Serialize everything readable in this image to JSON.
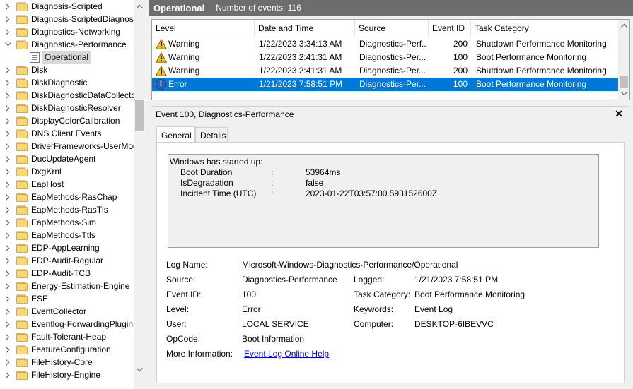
{
  "tree": {
    "items": [
      {
        "label": "Diagnosis-Scripted",
        "expanded": false
      },
      {
        "label": "Diagnosis-ScriptedDiagnost",
        "expanded": false
      },
      {
        "label": "Diagnostics-Networking",
        "expanded": false
      },
      {
        "label": "Diagnostics-Performance",
        "expanded": true
      },
      {
        "label": "Operational",
        "child": true,
        "selected": true
      },
      {
        "label": "Disk",
        "expanded": false
      },
      {
        "label": "DiskDiagnostic",
        "expanded": false
      },
      {
        "label": "DiskDiagnosticDataCollecto",
        "expanded": false
      },
      {
        "label": "DiskDiagnosticResolver",
        "expanded": false
      },
      {
        "label": "DisplayColorCalibration",
        "expanded": false
      },
      {
        "label": "DNS Client Events",
        "expanded": false
      },
      {
        "label": "DriverFrameworks-UserMod",
        "expanded": false
      },
      {
        "label": "DucUpdateAgent",
        "expanded": false
      },
      {
        "label": "DxgKrnl",
        "expanded": false
      },
      {
        "label": "EapHost",
        "expanded": false
      },
      {
        "label": "EapMethods-RasChap",
        "expanded": false
      },
      {
        "label": "EapMethods-RasTls",
        "expanded": false
      },
      {
        "label": "EapMethods-Sim",
        "expanded": false
      },
      {
        "label": "EapMethods-Ttls",
        "expanded": false
      },
      {
        "label": "EDP-AppLearning",
        "expanded": false
      },
      {
        "label": "EDP-Audit-Regular",
        "expanded": false
      },
      {
        "label": "EDP-Audit-TCB",
        "expanded": false
      },
      {
        "label": "Energy-Estimation-Engine",
        "expanded": false
      },
      {
        "label": "ESE",
        "expanded": false
      },
      {
        "label": "EventCollector",
        "expanded": false
      },
      {
        "label": "Eventlog-ForwardingPlugin",
        "expanded": false
      },
      {
        "label": "Fault-Tolerant-Heap",
        "expanded": false
      },
      {
        "label": "FeatureConfiguration",
        "expanded": false
      },
      {
        "label": "FileHistory-Core",
        "expanded": false
      },
      {
        "label": "FileHistory-Engine",
        "expanded": false
      }
    ]
  },
  "header": {
    "title": "Operational",
    "count": "Number of events: 116"
  },
  "events": {
    "columns": [
      "Level",
      "Date and Time",
      "Source",
      "Event ID",
      "Task Category"
    ],
    "rows": [
      {
        "level": "Warning",
        "date": "1/22/2023 3:34:13 AM",
        "source": "Diagnostics-Perf...",
        "id": "200",
        "task": "Shutdown Performance Monitoring",
        "icon": "warning-icon",
        "selected": false
      },
      {
        "level": "Warning",
        "date": "1/22/2023 2:41:31 AM",
        "source": "Diagnostics-Per...",
        "id": "100",
        "task": "Boot Performance Monitoring",
        "icon": "warning-icon",
        "selected": false
      },
      {
        "level": "Warning",
        "date": "1/22/2023 2:41:31 AM",
        "source": "Diagnostics-Per...",
        "id": "200",
        "task": "Shutdown Performance Monitoring",
        "icon": "warning-icon",
        "selected": false
      },
      {
        "level": "Error",
        "date": "1/21/2023 7:58:51 PM",
        "source": "Diagnostics-Per...",
        "id": "100",
        "task": "Boot Performance Monitoring",
        "icon": "error-icon",
        "selected": true
      }
    ]
  },
  "detail": {
    "title": "Event 100, Diagnostics-Performance",
    "tabs": [
      "General",
      "Details"
    ],
    "description": {
      "intro": "Windows has started up:",
      "fields": [
        {
          "name": "Boot Duration",
          "sep": ":",
          "value": "53964ms"
        },
        {
          "name": "IsDegradation",
          "sep": ":",
          "value": "false"
        },
        {
          "name": "Incident Time (UTC)",
          "sep": ":",
          "value": "2023-01-22T03:57:00.593152600Z"
        }
      ]
    },
    "props": {
      "log_name_label": "Log Name:",
      "log_name": "Microsoft-Windows-Diagnostics-Performance/Operational",
      "source_label": "Source:",
      "source": "Diagnostics-Performance",
      "logged_label": "Logged:",
      "logged": "1/21/2023 7:58:51 PM",
      "event_id_label": "Event ID:",
      "event_id": "100",
      "task_label": "Task Category:",
      "task": "Boot Performance Monitoring",
      "level_label": "Level:",
      "level": "Error",
      "keywords_label": "Keywords:",
      "keywords": "Event Log",
      "user_label": "User:",
      "user": "LOCAL SERVICE",
      "computer_label": "Computer:",
      "computer": "DESKTOP-6IBEVVC",
      "opcode_label": "OpCode:",
      "opcode": "Boot Information",
      "more_label": "More Information:",
      "more_link": "Event Log Online Help"
    }
  },
  "colors": {
    "selection": "#0078d7",
    "header_bg": "#6d6d6d",
    "link": "#0000ee"
  }
}
